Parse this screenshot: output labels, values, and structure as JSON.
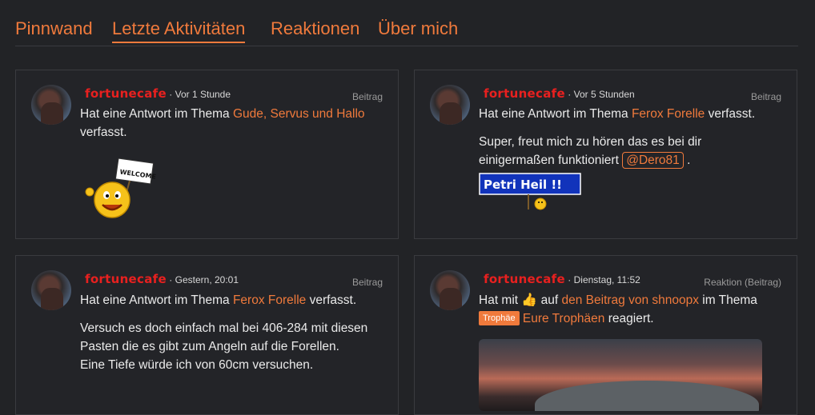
{
  "tabs": [
    {
      "label": "Pinnwand"
    },
    {
      "label": "Letzte Aktivitäten",
      "active": true
    },
    {
      "label": "Reaktionen"
    },
    {
      "label": "Über mich"
    }
  ],
  "cards": [
    {
      "user": "fortunecafe",
      "time": "· Vor 1 Stunde",
      "kind": "Beitrag",
      "line1_pre": "Hat eine Antwort im Thema ",
      "line1_link": "Gude, Servus und Hallo",
      "line2": "verfasst.",
      "sticker_text": "WELCOME!"
    },
    {
      "user": "fortunecafe",
      "time": "· Vor 5 Stunden",
      "kind": "Beitrag",
      "line1_pre": "Hat eine Antwort im Thema ",
      "line1_link": "Ferox Forelle",
      "line1_post": " verfasst.",
      "body1": "Super, freut mich zu hören das es bei dir",
      "body2_pre": "einigermaßen funktioniert ",
      "mention": "@Dero81",
      "body2_post": " .",
      "sign_text": "Petri Heil !!"
    },
    {
      "user": "fortunecafe",
      "time": "· Gestern, 20:01",
      "kind": "Beitrag",
      "line1_pre": "Hat eine Antwort im Thema ",
      "line1_link": "Ferox Forelle",
      "line1_post": " verfasst.",
      "body": [
        "Versuch es doch einfach mal bei 406-284 mit diesen",
        "Pasten die es gibt zum Angeln auf die Forellen.",
        "Eine Tiefe würde ich von 60cm versuchen."
      ]
    },
    {
      "user": "fortunecafe",
      "time": "· Dienstag, 11:52",
      "kind": "Reaktion (Beitrag)",
      "line1_pre": "Hat mit ",
      "line1_mid": " auf ",
      "line1_link": "den Beitrag von shnoopx",
      "line1_post": " im Thema",
      "badge": "Trophäe",
      "line2_link": "Eure Trophäen",
      "line2_post": " reagiert.",
      "reaction_icon": "thumbs-up-icon"
    }
  ]
}
